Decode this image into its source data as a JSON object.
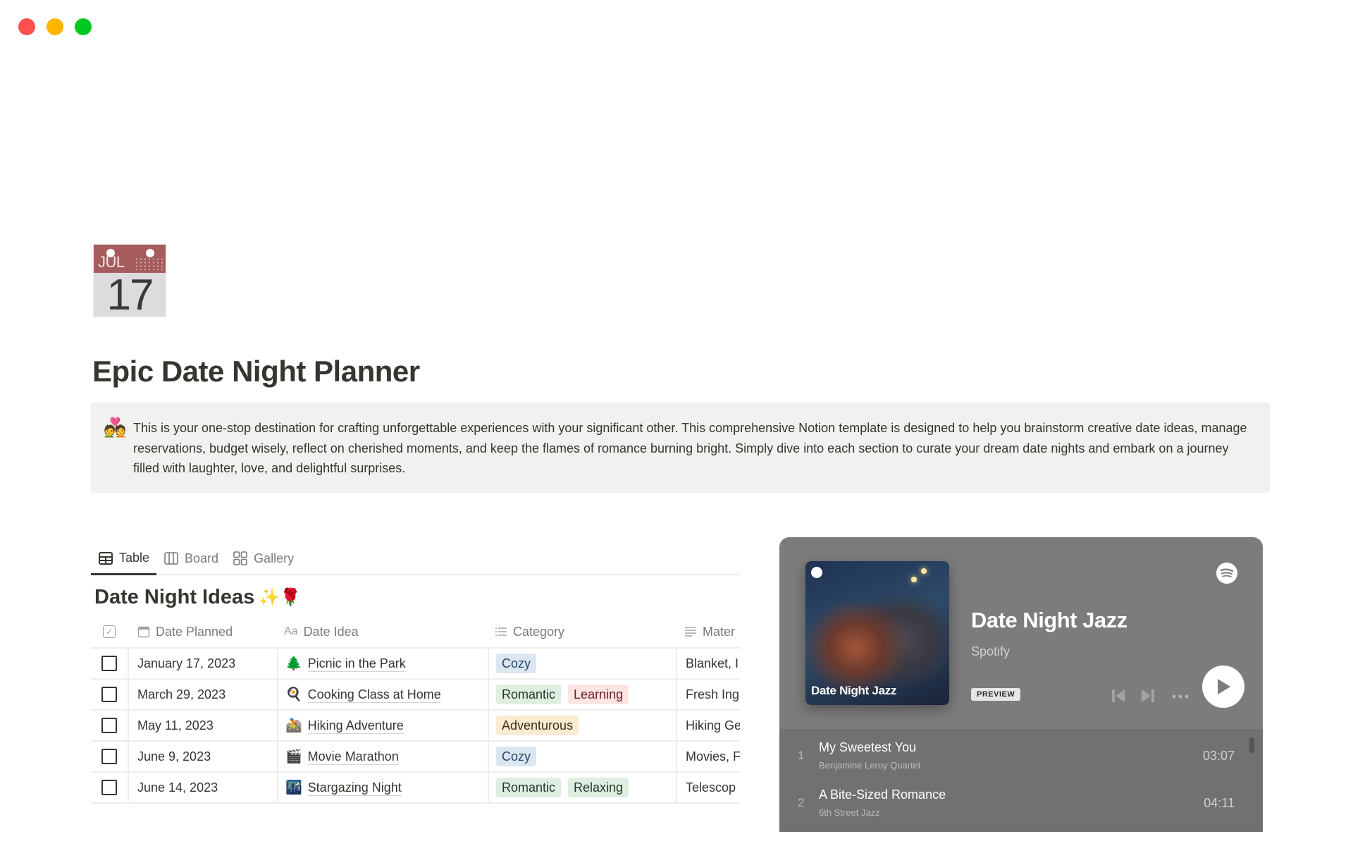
{
  "window": {
    "controls": [
      "close",
      "minimize",
      "maximize"
    ]
  },
  "page": {
    "icon": {
      "name": "calendar-icon",
      "month": "JUL",
      "day": "17"
    },
    "title": "Epic Date Night Planner",
    "callout": {
      "emoji": "💑",
      "text": "This is your one-stop destination for crafting unforgettable experiences with your significant other. This comprehensive Notion template is designed to help you brainstorm creative date ideas, manage reservations, budget wisely, reflect on cherished moments, and keep the flames of romance burning bright. Simply dive into each section to curate your dream date nights and embark on a journey filled with laughter, love, and delightful surprises."
    }
  },
  "views": {
    "tabs": [
      {
        "label": "Table",
        "icon": "table-icon",
        "active": true
      },
      {
        "label": "Board",
        "icon": "board-icon",
        "active": false
      },
      {
        "label": "Gallery",
        "icon": "gallery-icon",
        "active": false
      }
    ]
  },
  "database": {
    "title": "Date Night Ideas",
    "title_emoji": "✨🌹",
    "columns": [
      {
        "label": "",
        "icon": "checkbox-icon"
      },
      {
        "label": "Date Planned",
        "icon": "calendar-icon"
      },
      {
        "label": "Date Idea",
        "icon": "text-icon",
        "icon_text": "Aa"
      },
      {
        "label": "Category",
        "icon": "list-icon"
      },
      {
        "label": "Mater",
        "icon": "paragraph-icon"
      }
    ],
    "rows": [
      {
        "done": false,
        "date": "January 17, 2023",
        "emoji": "🌲",
        "idea": "Picnic in the Park",
        "tags": [
          {
            "label": "Cozy",
            "bg": "#dbe7f0",
            "fg": "#28456c"
          }
        ],
        "materials": "Blanket, I"
      },
      {
        "done": false,
        "date": "March 29, 2023",
        "emoji": "🍳",
        "idea": "Cooking Class at Home",
        "tags": [
          {
            "label": "Romantic",
            "bg": "#e0eee2",
            "fg": "#1c3829"
          },
          {
            "label": "Learning",
            "bg": "#fbe4e4",
            "fg": "#6e1f1f"
          }
        ],
        "materials": "Fresh Ing"
      },
      {
        "done": false,
        "date": "May 11, 2023",
        "emoji": "🚵",
        "idea": "Hiking Adventure",
        "tags": [
          {
            "label": "Adventurous",
            "bg": "#f9ecd0",
            "fg": "#402c1b"
          }
        ],
        "materials": "Hiking Ge"
      },
      {
        "done": false,
        "date": "June 9, 2023",
        "emoji": "🎬",
        "idea": "Movie Marathon",
        "tags": [
          {
            "label": "Cozy",
            "bg": "#dbe7f0",
            "fg": "#28456c"
          }
        ],
        "materials": "Movies, F"
      },
      {
        "done": false,
        "date": "June 14, 2023",
        "emoji": "🌃",
        "idea": "Stargazing Night",
        "tags": [
          {
            "label": "Romantic",
            "bg": "#e0eee2",
            "fg": "#1c3829"
          },
          {
            "label": "Relaxing",
            "bg": "#e0eee2",
            "fg": "#1c3829"
          }
        ],
        "materials": "Telescop"
      }
    ]
  },
  "spotify": {
    "cover_title": "Date Night Jazz",
    "title": "Date Night Jazz",
    "subtitle": "Spotify",
    "badge": "PREVIEW",
    "bg_color": "#7c7c7c",
    "tracks": [
      {
        "num": "1",
        "name": "My Sweetest You",
        "artist": "Benjamine Leroy Quartet",
        "duration": "03:07"
      },
      {
        "num": "2",
        "name": "A Bite-Sized Romance",
        "artist": "6th Street Jazz",
        "duration": "04:11"
      }
    ]
  }
}
